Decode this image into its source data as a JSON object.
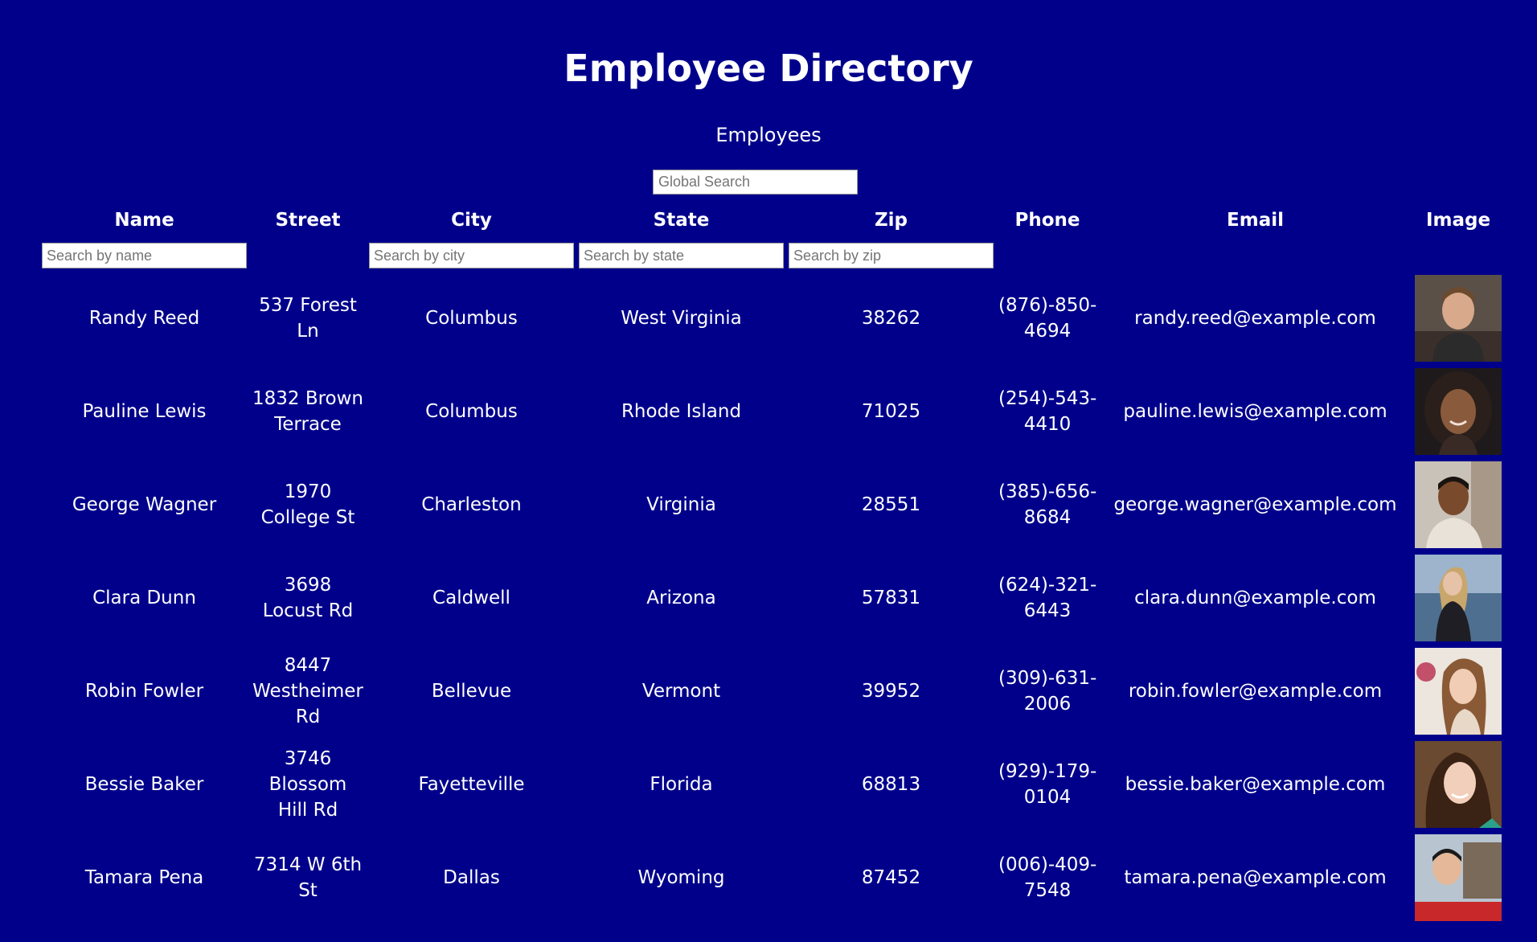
{
  "header": {
    "title": "Employee Directory",
    "subtitle": "Employees"
  },
  "search": {
    "global_placeholder": "Global Search"
  },
  "columns": [
    "Name",
    "Street",
    "City",
    "State",
    "Zip",
    "Phone",
    "Email",
    "Image"
  ],
  "filters": {
    "name_placeholder": "Search by name",
    "city_placeholder": "Search by city",
    "state_placeholder": "Search by state",
    "zip_placeholder": "Search by zip"
  },
  "employees": [
    {
      "name": "Randy Reed",
      "street": "537 Forest Ln",
      "city": "Columbus",
      "state": "West Virginia",
      "zip": "38262",
      "phone": "(876)-850-4694",
      "email": "randy.reed@example.com",
      "image": "portrait-photo"
    },
    {
      "name": "Pauline Lewis",
      "street": "1832 Brown Terrace",
      "city": "Columbus",
      "state": "Rhode Island",
      "zip": "71025",
      "phone": "(254)-543-4410",
      "email": "pauline.lewis@example.com",
      "image": "portrait-photo"
    },
    {
      "name": "George Wagner",
      "street": "1970 College St",
      "city": "Charleston",
      "state": "Virginia",
      "zip": "28551",
      "phone": "(385)-656-8684",
      "email": "george.wagner@example.com",
      "image": "portrait-photo"
    },
    {
      "name": "Clara Dunn",
      "street": "3698 Locust Rd",
      "city": "Caldwell",
      "state": "Arizona",
      "zip": "57831",
      "phone": "(624)-321-6443",
      "email": "clara.dunn@example.com",
      "image": "portrait-photo"
    },
    {
      "name": "Robin Fowler",
      "street": "8447 Westheimer Rd",
      "city": "Bellevue",
      "state": "Vermont",
      "zip": "39952",
      "phone": "(309)-631-2006",
      "email": "robin.fowler@example.com",
      "image": "portrait-photo"
    },
    {
      "name": "Bessie Baker",
      "street": "3746 Blossom Hill Rd",
      "city": "Fayetteville",
      "state": "Florida",
      "zip": "68813",
      "phone": "(929)-179-0104",
      "email": "bessie.baker@example.com",
      "image": "portrait-photo"
    },
    {
      "name": "Tamara Pena",
      "street": "7314 W 6th St",
      "city": "Dallas",
      "state": "Wyoming",
      "zip": "87452",
      "phone": "(006)-409-7548",
      "email": "tamara.pena@example.com",
      "image": "portrait-photo"
    }
  ],
  "colors": {
    "background": "#00008b",
    "text": "#ffffff"
  }
}
